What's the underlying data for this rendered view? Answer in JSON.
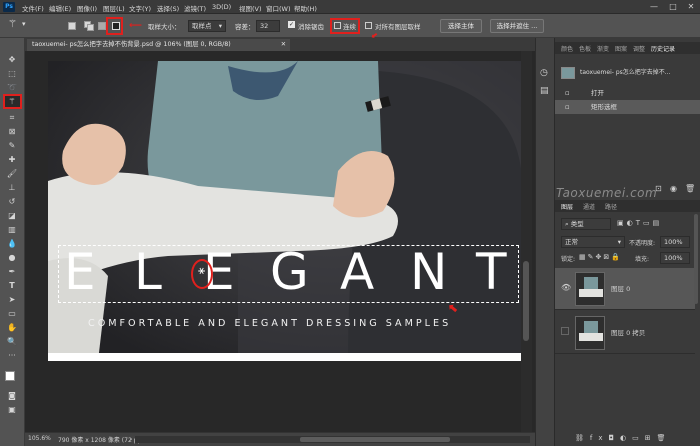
{
  "app": {
    "logo": "Ps"
  },
  "menu": [
    "文件(F)",
    "编辑(E)",
    "图像(I)",
    "图层(L)",
    "文字(Y)",
    "选择(S)",
    "滤镜(T)",
    "3D(D)",
    "视图(V)",
    "窗口(W)",
    "帮助(H)"
  ],
  "window_controls": {
    "minimize": "—",
    "maximize": "□",
    "close": "✕"
  },
  "options": {
    "sample_size_label": "取样大小：",
    "sample_size_value": "取样点",
    "tolerance_label": "容差：",
    "tolerance_value": "32",
    "antialias_label": "消除锯齿",
    "contiguous_label": "连续",
    "sample_all_label": "对所有图层取样",
    "select_subject": "选择主体",
    "select_mask": "选择并遮住 ..."
  },
  "document": {
    "tab_title": "taoxuemei- ps怎么把字去掉不伤背景.psd @ 106% (图层 0, RGB/8)",
    "tab_close": "✕"
  },
  "canvas": {
    "headline_letters": [
      "E",
      "L",
      "E",
      "G",
      "A",
      "N",
      "T"
    ],
    "subtitle": "COMFORTABLE AND ELEGANT DRESSING SAMPLES"
  },
  "status": {
    "zoom": "105.6%",
    "doc_info": "790 像素 x 1208 像素 (72 ppi)"
  },
  "top_panel": {
    "tabs": [
      "颜色",
      "色板",
      "渐变",
      "图案",
      "调整",
      "历史记录"
    ],
    "snapshot": "taoxuemei- ps怎么把字去掉不...",
    "history": [
      "打开",
      "矩形选框"
    ]
  },
  "watermark": "Taoxuemei.com",
  "layers_panel": {
    "tabs": [
      "图层",
      "通道",
      "路径"
    ],
    "filter_type": "类型",
    "blend_mode": "正常",
    "opacity_label": "不透明度:",
    "opacity_value": "100%",
    "lock_label": "锁定:",
    "fill_label": "填充:",
    "fill_value": "100%",
    "layers": [
      {
        "name": "图层 0",
        "visible": true
      },
      {
        "name": "图层 0 拷贝",
        "visible": false
      }
    ]
  },
  "colors": {
    "accent_red": "#e0201d",
    "ps_blue": "#2fa3ff"
  }
}
